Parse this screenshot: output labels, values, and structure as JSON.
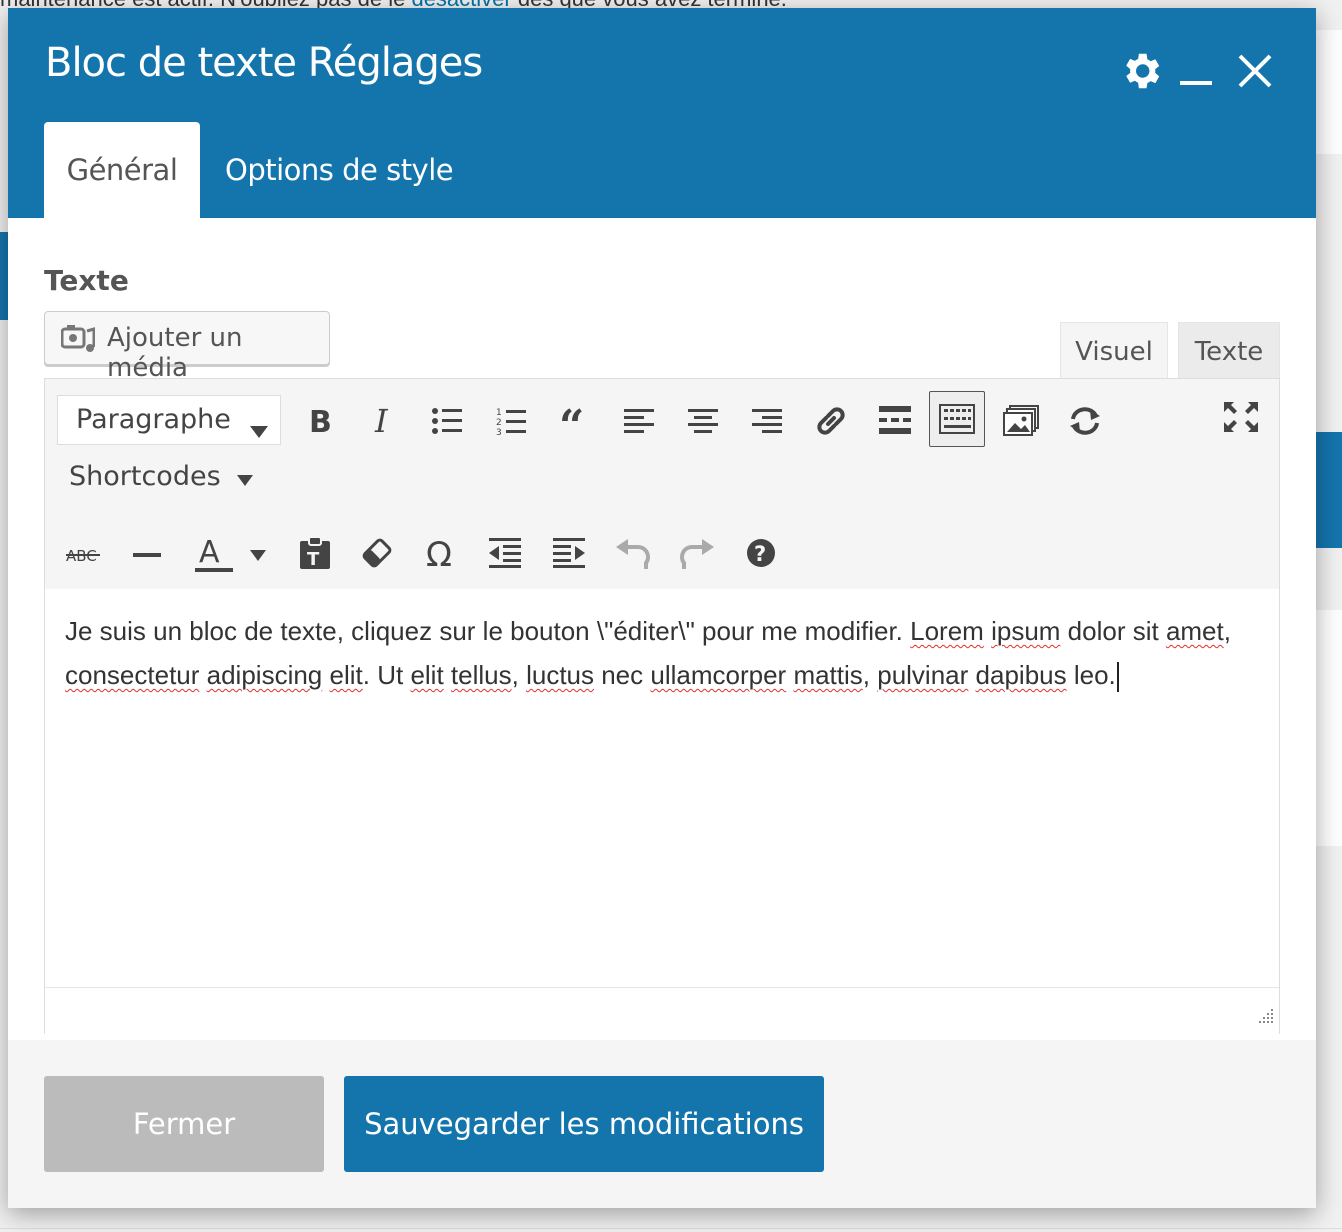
{
  "background": {
    "notice_prefix": "maintenance est actif. N'oubliez pas de le",
    "notice_link": "désactiver",
    "notice_suffix": "dès que vous avez terminé."
  },
  "modal": {
    "title": "Bloc de texte Réglages",
    "header_icons": [
      "gear-icon",
      "minimize-icon",
      "close-icon"
    ],
    "tabs": [
      {
        "label": "Général",
        "active": true
      },
      {
        "label": "Options de style",
        "active": false
      }
    ]
  },
  "field": {
    "label": "Texte",
    "add_media_label": "Ajouter un média"
  },
  "editor": {
    "mode_tabs": [
      "Visuel",
      "Texte"
    ],
    "active_mode": "Visuel",
    "format_select": "Paragraphe",
    "shortcodes_label": "Shortcodes",
    "toolbar_row1": [
      "bold-icon",
      "italic-icon",
      "bullet-list-icon",
      "numbered-list-icon",
      "blockquote-icon",
      "align-left-icon",
      "align-center-icon",
      "align-right-icon",
      "link-icon",
      "read-more-icon",
      "toolbar-toggle-icon",
      "gallery-icon",
      "refresh-icon",
      "fullscreen-icon"
    ],
    "toolbar_row2": [
      "strikethrough-icon",
      "horizontal-line-icon",
      "text-color-icon",
      "paste-text-icon",
      "clear-formatting-icon",
      "special-char-icon",
      "outdent-icon",
      "indent-icon",
      "undo-icon",
      "redo-icon",
      "help-icon"
    ],
    "content": {
      "part1": "Je suis un bloc de texte, cliquez sur le bouton \\\"éditer\\\" pour me modifier. ",
      "w_lorem": "Lorem",
      "w_ipsum": "ipsum",
      "part2": " dolor sit ",
      "w_amet": "amet",
      "sep1": ", ",
      "w_consectetur": "consectetur",
      "sp1": " ",
      "w_adipiscing": "adipiscing",
      "sp2": " ",
      "w_elit": "elit",
      "part3": ". Ut ",
      "w_elit2": "elit",
      "sp3": " ",
      "w_tellus": "tellus",
      "sep2": ", ",
      "w_luctus": "luctus",
      "part4": " nec ",
      "w_ullamcorper": "ullamcorper",
      "sp4": " ",
      "w_mattis": "mattis",
      "sep3": ", ",
      "w_pulvinar": "pulvinar",
      "sp5": " ",
      "w_dapibus": "dapibus",
      "part5": " leo."
    }
  },
  "footer": {
    "close_label": "Fermer",
    "save_label": "Sauvegarder les modifications"
  },
  "colors": {
    "primary": "#1475ad",
    "close_button": "#bbbbbb",
    "toolbar_bg": "#f5f5f5"
  }
}
